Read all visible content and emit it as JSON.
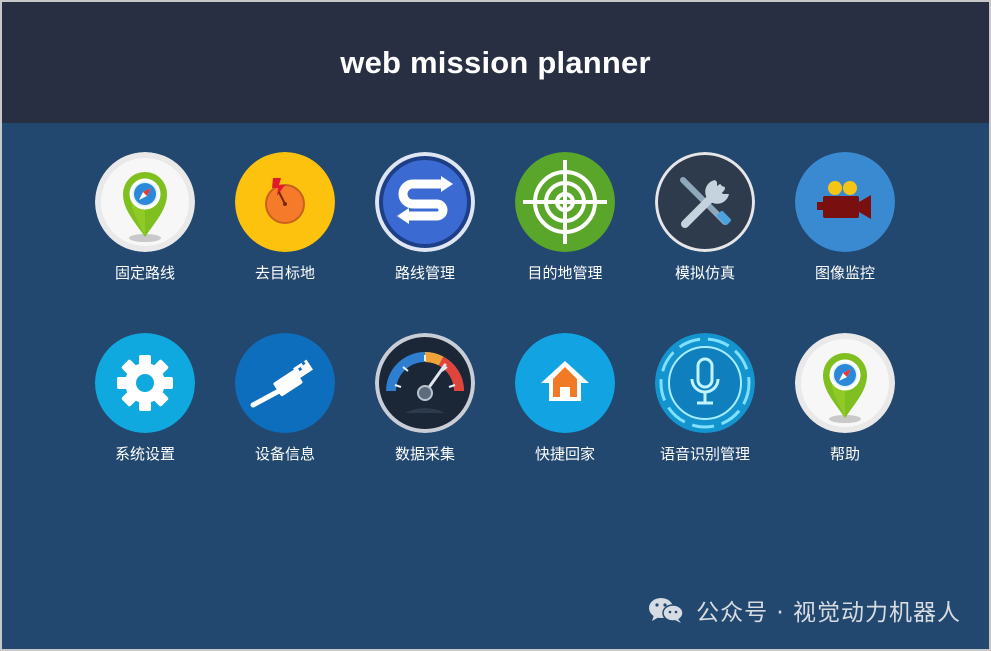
{
  "header": {
    "title": "web mission planner"
  },
  "tiles": [
    {
      "label": "固定路线",
      "icon": "map-pin-compass-icon"
    },
    {
      "label": "去目标地",
      "icon": "target-compass-icon"
    },
    {
      "label": "路线管理",
      "icon": "s-arrows-icon"
    },
    {
      "label": "目的地管理",
      "icon": "crosshair-icon"
    },
    {
      "label": "模拟仿真",
      "icon": "wrench-screwdriver-icon"
    },
    {
      "label": "图像监控",
      "icon": "video-camera-icon"
    },
    {
      "label": "系统设置",
      "icon": "gear-icon"
    },
    {
      "label": "设备信息",
      "icon": "usb-cable-icon"
    },
    {
      "label": "数据采集",
      "icon": "speedometer-icon"
    },
    {
      "label": "快捷回家",
      "icon": "home-icon"
    },
    {
      "label": "语音识别管理",
      "icon": "microphone-icon"
    },
    {
      "label": "帮助",
      "icon": "map-pin-compass-icon"
    }
  ],
  "watermark": {
    "text": "公众号 · 视觉动力机器人",
    "icon": "wechat-icon"
  },
  "colors": {
    "header_bg": "#282f42",
    "body_bg": "#23486f",
    "yellow": "#f7c20f",
    "green": "#5aa62a",
    "cyan": "#10a9df",
    "blue": "#0d6ebd"
  }
}
